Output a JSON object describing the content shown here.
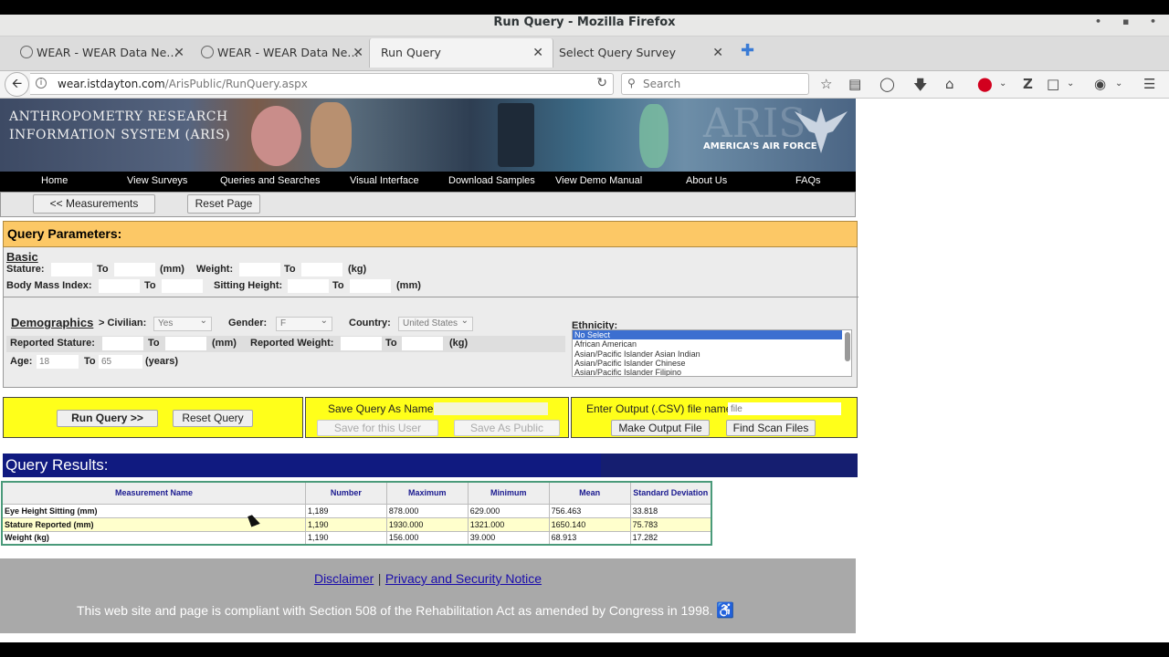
{
  "window": {
    "title": "Run Query - Mozilla Firefox"
  },
  "tabs": [
    {
      "label": "WEAR - WEAR Data Ne…"
    },
    {
      "label": "WEAR - WEAR Data Ne…"
    },
    {
      "label": "Run Query"
    },
    {
      "label": "Select Query Survey"
    }
  ],
  "url": {
    "domain": "wear.istdayton.com",
    "path": "/ArisPublic/RunQuery.aspx"
  },
  "search": {
    "placeholder": "Search"
  },
  "banner": {
    "line1": "Anthropometry Research",
    "line2": "Information System (ARIS)",
    "air_force": "AMERICA'S AIR FORCE",
    "watermark": "ARIS"
  },
  "menu": [
    "Home",
    "View Surveys",
    "Queries and Searches",
    "Visual Interface",
    "Download Samples",
    "View Demo Manual",
    "About Us",
    "FAQs"
  ],
  "toolbar": {
    "measurements": "<< Measurements",
    "reset_page": "Reset Page"
  },
  "query": {
    "header": "Query Parameters:",
    "basic": "Basic",
    "stature": "Stature:",
    "to": "To",
    "mm": "(mm)",
    "weight": "Weight:",
    "kg": "(kg)",
    "bmi": "Body Mass Index:",
    "sitting_height": "Sitting Height:",
    "demographics": "Demographics",
    "civilian": "> Civilian:",
    "civilian_value": "Yes",
    "gender": "Gender:",
    "gender_value": "F",
    "country": "Country:",
    "country_value": "United States",
    "ethnicity": "Ethnicity:",
    "ethnicity_options": [
      "No Select",
      "African American",
      "Asian/Pacific Islander Asian Indian",
      "Asian/Pacific Islander Chinese",
      "Asian/Pacific Islander Filipino"
    ],
    "reported_stature": "Reported Stature:",
    "reported_weight": "Reported Weight:",
    "age": "Age:",
    "age_from": "18",
    "age_to": "65",
    "years": "(years)"
  },
  "actions": {
    "run_query": "Run Query >>",
    "reset_query": "Reset Query",
    "save_as_name": "Save Query As Name:",
    "save_user": "Save for this User",
    "save_public": "Save As Public",
    "output_label": "Enter Output (.CSV) file name:",
    "output_value": "file",
    "make_output": "Make Output File",
    "find_scan": "Find Scan Files"
  },
  "results": {
    "header": "Query Results:",
    "columns": [
      "Measurement Name",
      "Number",
      "Maximum",
      "Minimum",
      "Mean",
      "Standard Deviation"
    ],
    "rows": [
      [
        "Eye Height Sitting (mm)",
        "1,189",
        "878.000",
        "629.000",
        "756.463",
        "33.818"
      ],
      [
        "Stature Reported (mm)",
        "1,190",
        "1930.000",
        "1321.000",
        "1650.140",
        "75.783"
      ],
      [
        "Weight (kg)",
        "1,190",
        "156.000",
        "39.000",
        "68.913",
        "17.282"
      ]
    ]
  },
  "footer": {
    "disclaimer": "Disclaimer",
    "sep": "|",
    "privacy": "Privacy and Security Notice",
    "compliance": "This web site and page is compliant with Section 508 of the Rehabilitation Act as amended by Congress in 1998."
  }
}
